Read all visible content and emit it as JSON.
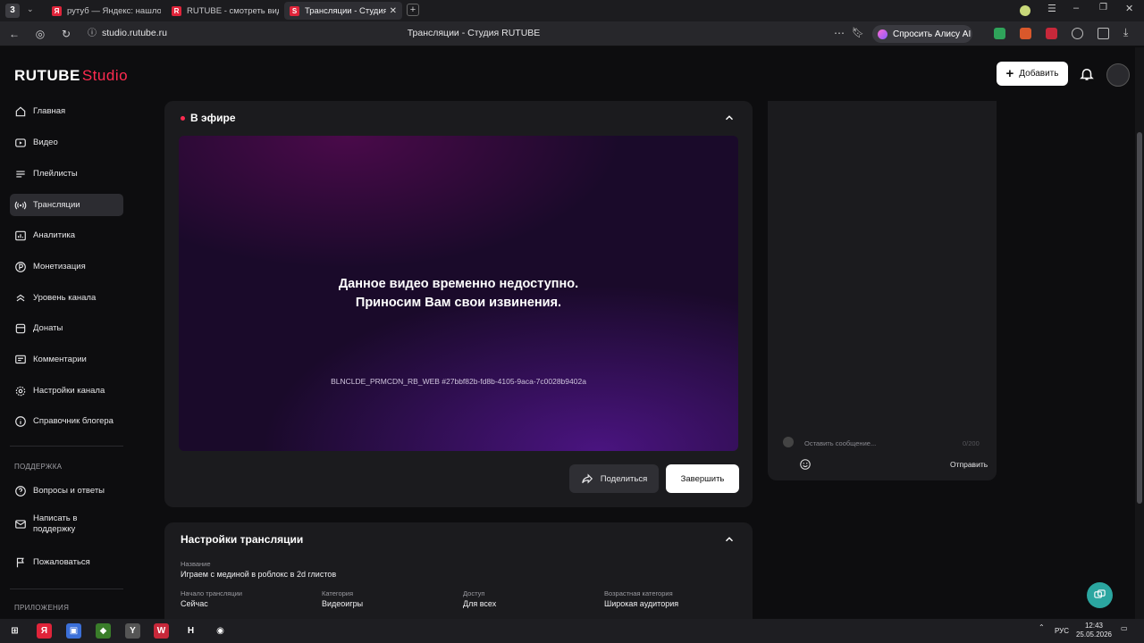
{
  "browser": {
    "tabs": [
      {
        "label": "рутуб — Яндекс: нашлось",
        "icon": "yandex-icon",
        "color": "#e0243a"
      },
      {
        "label": "RUTUBE - смотреть видео",
        "icon": "rutube-icon",
        "color": "#e0243a"
      },
      {
        "label": "Трансляции - Студия RUTUBE",
        "icon": "rutube-studio-icon",
        "color": "#e0243a"
      }
    ],
    "url": "studio.rutube.ru",
    "page_title": "Трансляции - Студия RUTUBE",
    "alice_label": "Спросить Алису AI"
  },
  "header": {
    "logo_main": "RUTUBE",
    "logo_sub": "Studio",
    "add_label": "Добавить"
  },
  "sidebar": {
    "items": [
      {
        "label": "Главная",
        "icon": "home-icon"
      },
      {
        "label": "Видео",
        "icon": "video-icon"
      },
      {
        "label": "Плейлисты",
        "icon": "playlist-icon"
      },
      {
        "label": "Трансляции",
        "icon": "broadcast-icon",
        "active": true
      },
      {
        "label": "Аналитика",
        "icon": "analytics-icon"
      },
      {
        "label": "Монетизация",
        "icon": "monetization-icon"
      },
      {
        "label": "Уровень канала",
        "icon": "level-icon"
      },
      {
        "label": "Донаты",
        "icon": "donate-icon"
      },
      {
        "label": "Комментарии",
        "icon": "comments-icon"
      },
      {
        "label": "Настройки канала",
        "icon": "gear-icon"
      },
      {
        "label": "Справочник блогера",
        "icon": "info-icon"
      }
    ],
    "support_section": "ПОДДЕРЖКА",
    "support_items": [
      {
        "label": "Вопросы и ответы",
        "icon": "question-icon"
      },
      {
        "label": "Написать в поддержку",
        "icon": "mail-icon"
      },
      {
        "label": "Пожаловаться",
        "icon": "flag-icon"
      }
    ],
    "apps_section": "ПРИЛОЖЕНИЯ"
  },
  "live": {
    "title": "В эфире",
    "error_line1": "Данное видео временно недоступно.",
    "error_line2": "Приносим Вам свои извинения.",
    "error_code": "BLNCLDE_PRMCDN_RB_WEB #27bbf82b-fd8b-4105-9aca-7c0028b9402a",
    "share_label": "Поделиться",
    "finish_label": "Завершить"
  },
  "chat": {
    "placeholder": "Оставить сообщение...",
    "counter": "0/200",
    "send_label": "Отправить"
  },
  "settings": {
    "title": "Настройки трансляции",
    "name_label": "Название",
    "name_value": "Играем с мединой в роблокс в 2d глистов",
    "fields": [
      {
        "label": "Начало трансляции",
        "value": "Сейчас"
      },
      {
        "label": "Категория",
        "value": "Видеоигры"
      },
      {
        "label": "Доступ",
        "value": "Для всех"
      },
      {
        "label": "Возрастная категория",
        "value": "Широкая аудитория"
      }
    ]
  },
  "taskbar": {
    "lang": "РУС",
    "time": "12:43",
    "date": "25.05.2026"
  },
  "colors": {
    "accent": "#ff2b50",
    "card": "#1b1b1e",
    "bg": "#0d0d0f"
  }
}
